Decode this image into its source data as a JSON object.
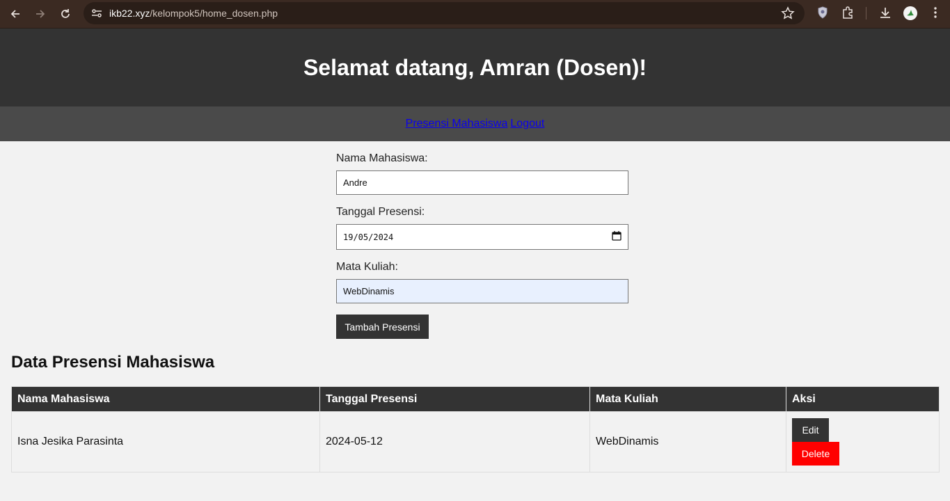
{
  "browser": {
    "url_host": "ikb22.xyz",
    "url_path": "/kelompok5/home_dosen.php"
  },
  "header": {
    "title": "Selamat datang, Amran (Dosen)!"
  },
  "nav": {
    "items": [
      {
        "label": "Presensi Mahasiswa"
      },
      {
        "label": "Logout"
      }
    ]
  },
  "form": {
    "name_label": "Nama Mahasiswa:",
    "name_value": "Andre",
    "date_label": "Tanggal Presensi:",
    "date_value": "19/05/2024",
    "course_label": "Mata Kuliah:",
    "course_value": "WebDinamis",
    "submit_label": "Tambah Presensi"
  },
  "table": {
    "title": "Data Presensi Mahasiswa",
    "headers": [
      "Nama Mahasiswa",
      "Tanggal Presensi",
      "Mata Kuliah",
      "Aksi"
    ],
    "rows": [
      {
        "name": "Isna Jesika Parasinta",
        "date": "2024-05-12",
        "course": "WebDinamis",
        "edit": "Edit",
        "delete": "Delete"
      }
    ]
  },
  "colors": {
    "header_bg": "#333333",
    "nav_bg": "#4a4a4a",
    "delete_btn": "#ff0000",
    "link": "#0b00ee"
  }
}
